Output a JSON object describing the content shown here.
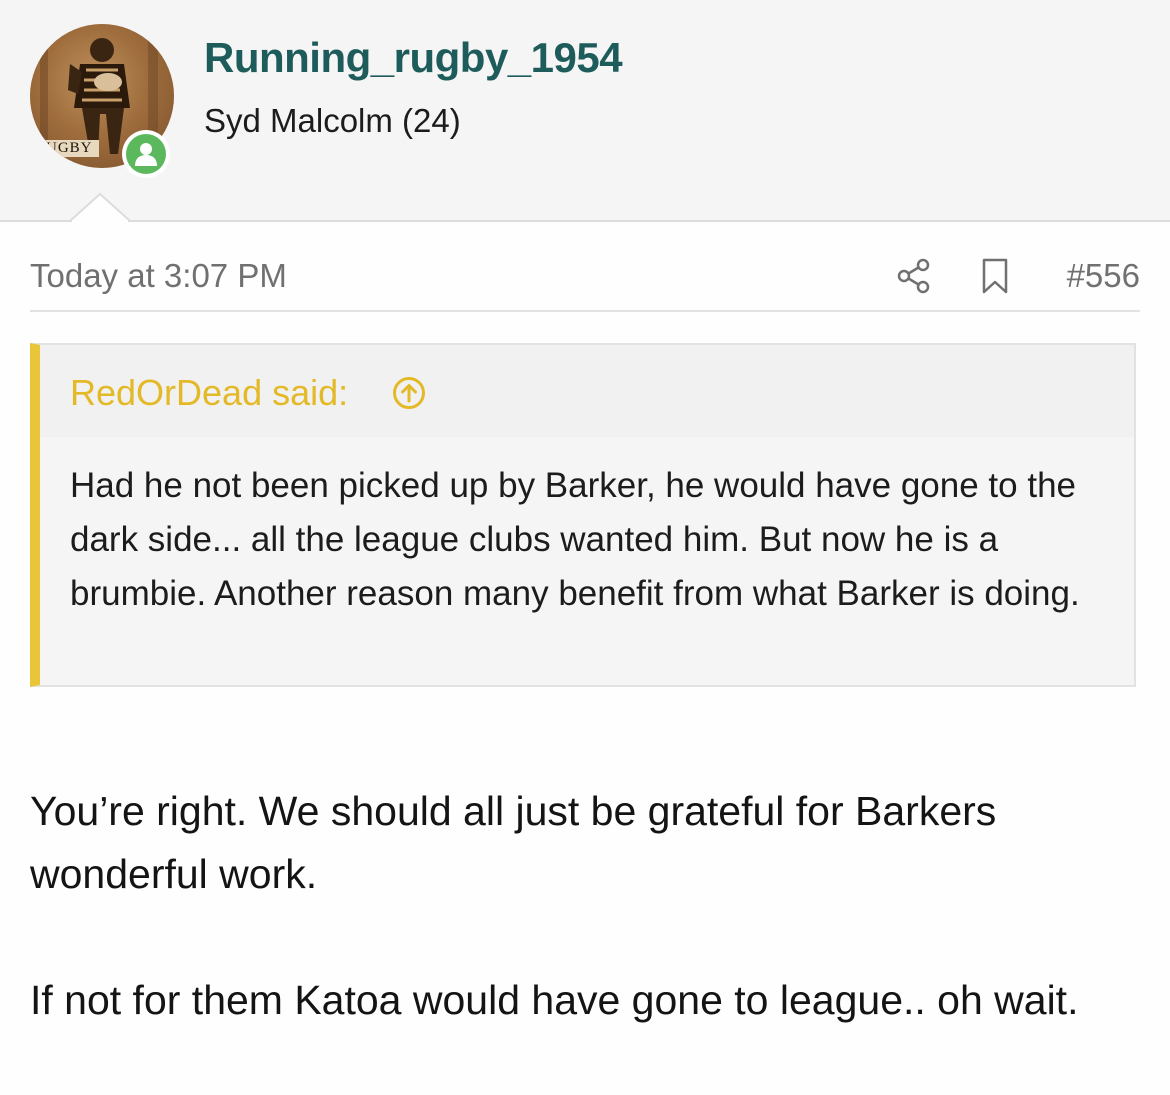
{
  "user": {
    "username": "Running_rugby_1954",
    "title": "Syd Malcolm (24)",
    "avatar_caption": "UGBY",
    "avatar_icon": "rugby-player-photo",
    "online_icon": "user-icon",
    "username_color": "#1e5c5c",
    "online_color": "#5cb85c"
  },
  "post": {
    "date": "Today at 3:07 PM",
    "share_icon": "share-icon",
    "bookmark_icon": "bookmark-icon",
    "number": "#556"
  },
  "quote": {
    "author_label": "RedOrDead said:",
    "jump_icon": "arrow-up-circle-icon",
    "body": "Had he not been picked up by Barker, he would have gone to the dark side... all the league clubs wanted him. But now he is a brumbie. Another reason many benefit from what Barker is doing.",
    "accent_color": "#e9c53a"
  },
  "message": {
    "paragraphs": [
      "You’re right. We should all just be grateful for Barkers wonderful work.",
      "If not for them Katoa would have gone to league.. oh wait."
    ]
  }
}
